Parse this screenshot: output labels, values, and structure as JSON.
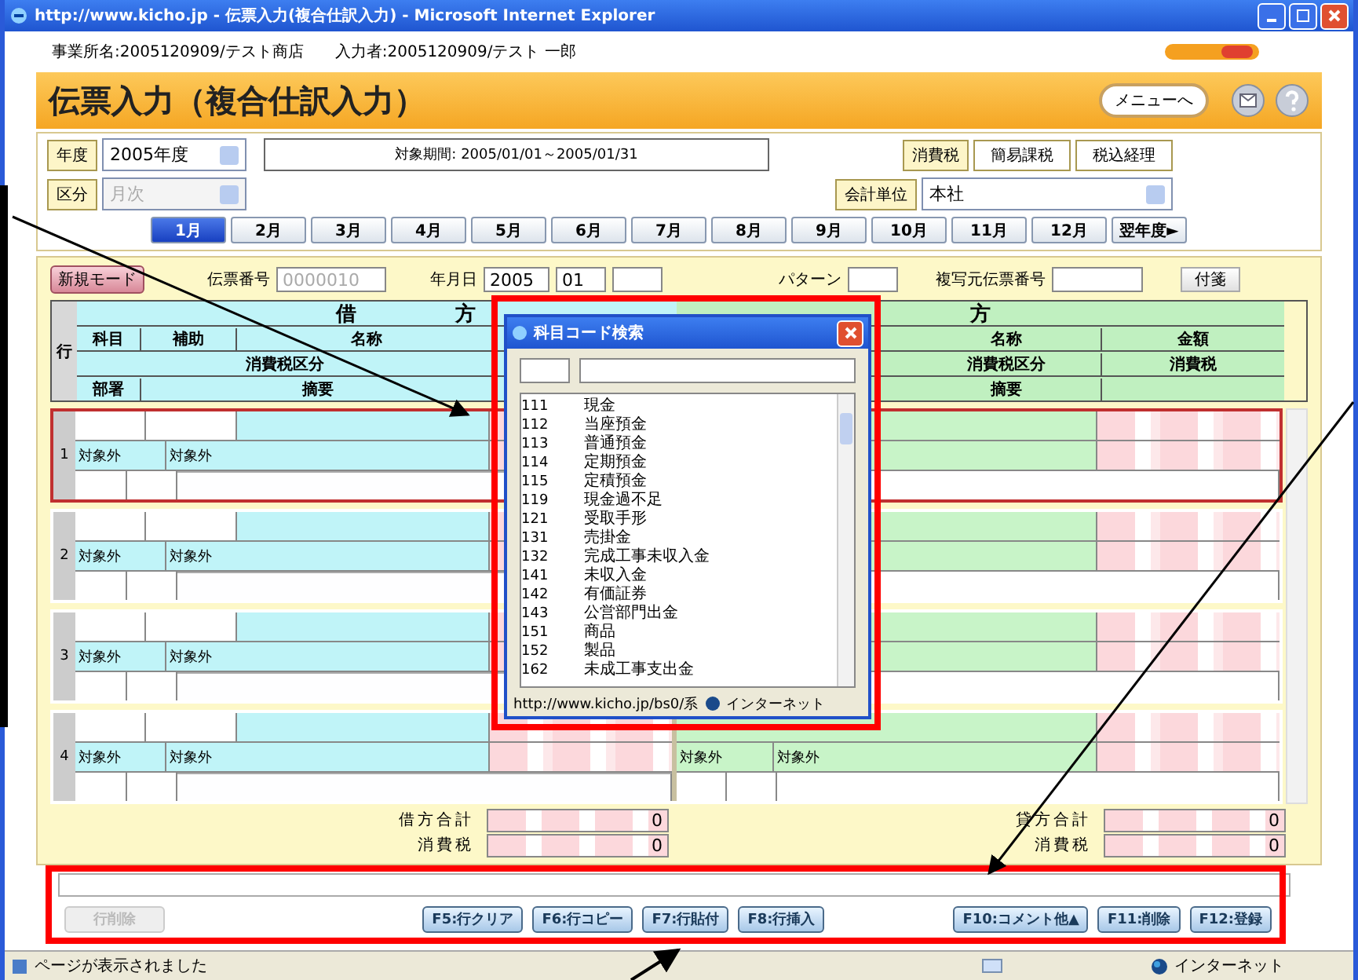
{
  "window": {
    "title": "http://www.kicho.jp - 伝票入力(複合仕訳入力) - Microsoft Internet Explorer"
  },
  "info_line": {
    "office": "事業所名:2005120909/テスト商店",
    "operator": "入力者:2005120909/テスト 一郎"
  },
  "header": {
    "title": "伝票入力（複合仕訳入力）",
    "menu_button": "メニューへ"
  },
  "fiscal": {
    "year_label": "年度",
    "year_value": "2005年度",
    "period": "対象期間: 2005/01/01～2005/01/31",
    "division_label": "区分",
    "division_value": "月次",
    "division_disabled": true,
    "tax_label": "消費税",
    "tax_method": "簡易課税",
    "tax_accounting": "税込経理",
    "unit_label": "会計単位",
    "unit_value": "本社"
  },
  "months": [
    {
      "label": "1月",
      "selected": true
    },
    {
      "label": "2月",
      "selected": false
    },
    {
      "label": "3月",
      "selected": false
    },
    {
      "label": "4月",
      "selected": false
    },
    {
      "label": "5月",
      "selected": false
    },
    {
      "label": "6月",
      "selected": false
    },
    {
      "label": "7月",
      "selected": false
    },
    {
      "label": "8月",
      "selected": false
    },
    {
      "label": "9月",
      "selected": false
    },
    {
      "label": "10月",
      "selected": false
    },
    {
      "label": "11月",
      "selected": false
    },
    {
      "label": "12月",
      "selected": false
    },
    {
      "label": "翌年度►",
      "selected": false
    }
  ],
  "voucher": {
    "mode_button": "新規モード",
    "number_label": "伝票番号",
    "number_value": "0000010",
    "date_label": "年月日",
    "year": "2005",
    "month": "01",
    "pattern_label": "パターン",
    "copy_label": "複写元伝票番号",
    "sticky_button": "付箋"
  },
  "table_header": {
    "row": "行",
    "debit": "借　　　方",
    "credit": "方",
    "debit_account": "科目",
    "debit_sub": "補助",
    "debit_name": "名称",
    "debit_tax_class": "消費税区分",
    "debit_dept": "部署",
    "debit_memo": "摘要",
    "credit_name": "名称",
    "credit_amount": "金額",
    "credit_tax_class": "消費税区分",
    "credit_tax": "消費税",
    "credit_memo": "摘要"
  },
  "rows": [
    {
      "no": "1",
      "selected": true,
      "debit_tax": [
        "対象外",
        "対象外"
      ],
      "credit_tax": []
    },
    {
      "no": "2",
      "selected": false,
      "debit_tax": [
        "対象外",
        "対象外"
      ],
      "credit_tax": []
    },
    {
      "no": "3",
      "selected": false,
      "debit_tax": [
        "対象外",
        "対象外"
      ],
      "credit_tax": []
    },
    {
      "no": "4",
      "selected": false,
      "debit_tax": [
        "対象外",
        "対象外"
      ],
      "credit_tax": [
        "対象外",
        "対象外"
      ]
    }
  ],
  "totals": [
    {
      "label": "借方合計",
      "value": "0",
      "tax_label": "消費税",
      "tax_value": "0"
    },
    {
      "label": "貸方合計",
      "value": "0",
      "tax_label": "消費税",
      "tax_value": "0"
    }
  ],
  "footer_buttons_left": [
    {
      "label": "行削除",
      "disabled": true
    }
  ],
  "footer_buttons_center": [
    {
      "label": "F5:行クリア",
      "disabled": false
    },
    {
      "label": "F6:行コピー",
      "disabled": false
    },
    {
      "label": "F7:行貼付",
      "disabled": false
    },
    {
      "label": "F8:行挿入",
      "disabled": false
    }
  ],
  "footer_buttons_right": [
    {
      "label": "F10:コメント他▲",
      "disabled": false
    },
    {
      "label": "F11:削除",
      "disabled": false
    },
    {
      "label": "F12:登録",
      "disabled": false
    }
  ],
  "popup": {
    "title": "科目コード検索",
    "items": [
      {
        "code": "111",
        "name": "現金"
      },
      {
        "code": "112",
        "name": "当座預金"
      },
      {
        "code": "113",
        "name": "普通預金"
      },
      {
        "code": "114",
        "name": "定期預金"
      },
      {
        "code": "115",
        "name": "定積預金"
      },
      {
        "code": "119",
        "name": "現金過不足"
      },
      {
        "code": "121",
        "name": "受取手形"
      },
      {
        "code": "131",
        "name": "売掛金"
      },
      {
        "code": "132",
        "name": "完成工事未収入金"
      },
      {
        "code": "141",
        "name": "未収入金"
      },
      {
        "code": "142",
        "name": "有価証券"
      },
      {
        "code": "143",
        "name": "公営部門出金"
      },
      {
        "code": "151",
        "name": "商品"
      },
      {
        "code": "152",
        "name": "製品"
      },
      {
        "code": "162",
        "name": "未成工事支出金"
      }
    ],
    "status_url": "http://www.kicho.jp/bs0/系",
    "zone": "インターネット"
  },
  "status_bar": {
    "text": "ページが表示されました",
    "zone": "インターネット"
  }
}
